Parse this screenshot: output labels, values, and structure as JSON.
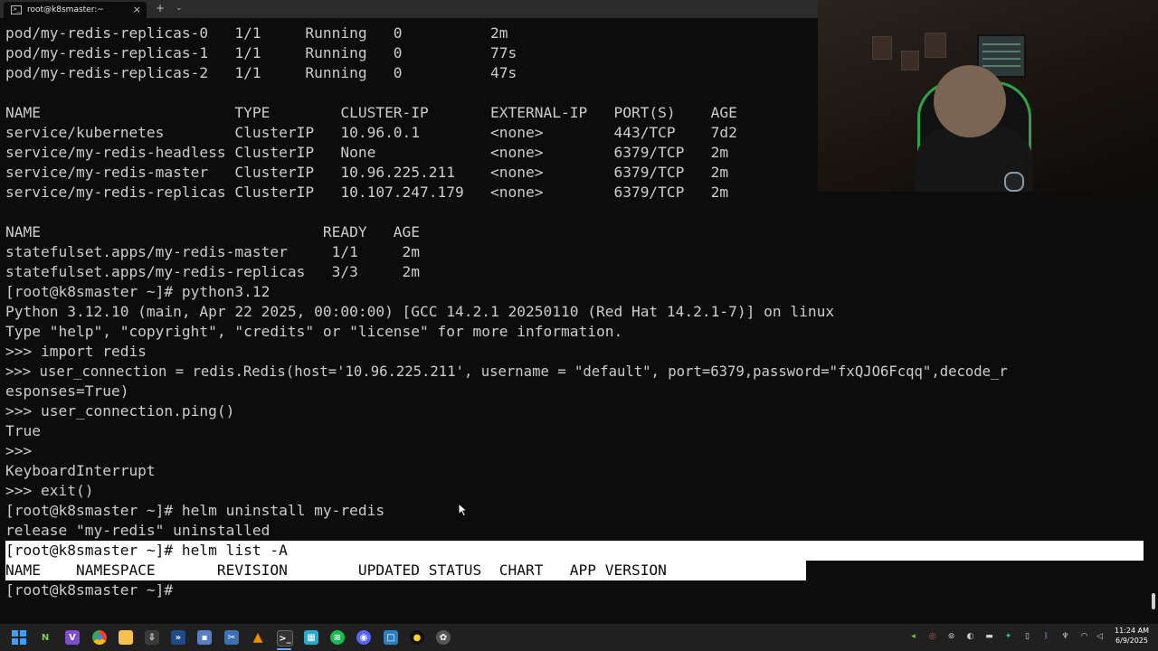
{
  "window": {
    "tab_title": "root@k8smaster:~",
    "close_glyph": "×",
    "new_tab_glyph": "+",
    "dropdown_glyph": "⌄"
  },
  "terminal": {
    "lines": [
      "pod/my-redis-replicas-0   1/1     Running   0          2m",
      "pod/my-redis-replicas-1   1/1     Running   0          77s",
      "pod/my-redis-replicas-2   1/1     Running   0          47s",
      "",
      "NAME                      TYPE        CLUSTER-IP       EXTERNAL-IP   PORT(S)    AGE",
      "service/kubernetes        ClusterIP   10.96.0.1        <none>        443/TCP    7d2",
      "service/my-redis-headless ClusterIP   None             <none>        6379/TCP   2m",
      "service/my-redis-master   ClusterIP   10.96.225.211    <none>        6379/TCP   2m",
      "service/my-redis-replicas ClusterIP   10.107.247.179   <none>        6379/TCP   2m",
      "",
      "NAME                                READY   AGE",
      "statefulset.apps/my-redis-master     1/1     2m",
      "statefulset.apps/my-redis-replicas   3/3     2m",
      "[root@k8smaster ~]# python3.12",
      "Python 3.12.10 (main, Apr 22 2025, 00:00:00) [GCC 14.2.1 20250110 (Red Hat 14.2.1-7)] on linux",
      "Type \"help\", \"copyright\", \"credits\" or \"license\" for more information.",
      ">>> import redis",
      ">>> user_connection = redis.Redis(host='10.96.225.211', username = \"default\", port=6379,password=\"fxQJO6Fcqq\",decode_r",
      "esponses=True)",
      ">>> user_connection.ping()",
      "True",
      ">>>",
      "KeyboardInterrupt",
      ">>> exit()",
      "[root@k8smaster ~]# helm uninstall my-redis",
      "release \"my-redis\" uninstalled",
      "[root@k8smaster ~]# helm list -A",
      "NAME    NAMESPACE       REVISION        UPDATED STATUS  CHART   APP VERSION",
      "[root@k8smaster ~]# "
    ]
  },
  "taskbar": {
    "apps": [
      "start-icon",
      "notepad-plus-icon",
      "visual-studio-icon",
      "chrome-icon",
      "file-explorer-icon",
      "app-icon",
      "terminal-app-icon",
      "save-icon",
      "snipping-icon",
      "vlc-icon",
      "terminal-icon",
      "calculator-icon",
      "spotify-icon",
      "discord-icon",
      "app-square-icon",
      "record-icon",
      "github-icon"
    ],
    "clock_time": "11:24 AM",
    "clock_date": "6/9/2025"
  }
}
